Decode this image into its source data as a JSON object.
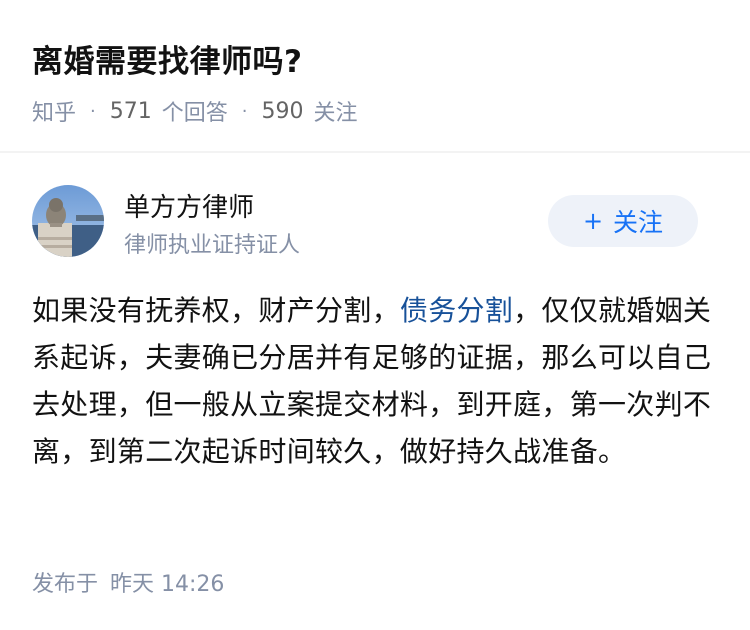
{
  "question": {
    "title": "离婚需要找律师吗?",
    "source": "知乎",
    "separator": "·",
    "answer_count": "571",
    "answer_label": "个回答",
    "follower_count": "590",
    "follower_label": "关注"
  },
  "author": {
    "name": "单方方律师",
    "bio": "律师执业证持证人",
    "follow_plus": "+",
    "follow_label": "关注"
  },
  "answer": {
    "text_before": "如果没有抚养权，财产分割，",
    "link_text": "债务分割",
    "text_after": "，仅仅就婚姻关系起诉，夫妻确已分居并有足够的证据，那么可以自己去处理，但一般从立案提交材料，到开庭，第一次判不离，到第二次起诉时间较久，做好持久战准备。"
  },
  "footer": {
    "published_label": "发布于",
    "published_time": "昨天 14:26"
  },
  "colors": {
    "link": "#175199",
    "meta": "#8590a6",
    "follow_bg": "#eef2f9",
    "follow_text": "#1772f6"
  }
}
